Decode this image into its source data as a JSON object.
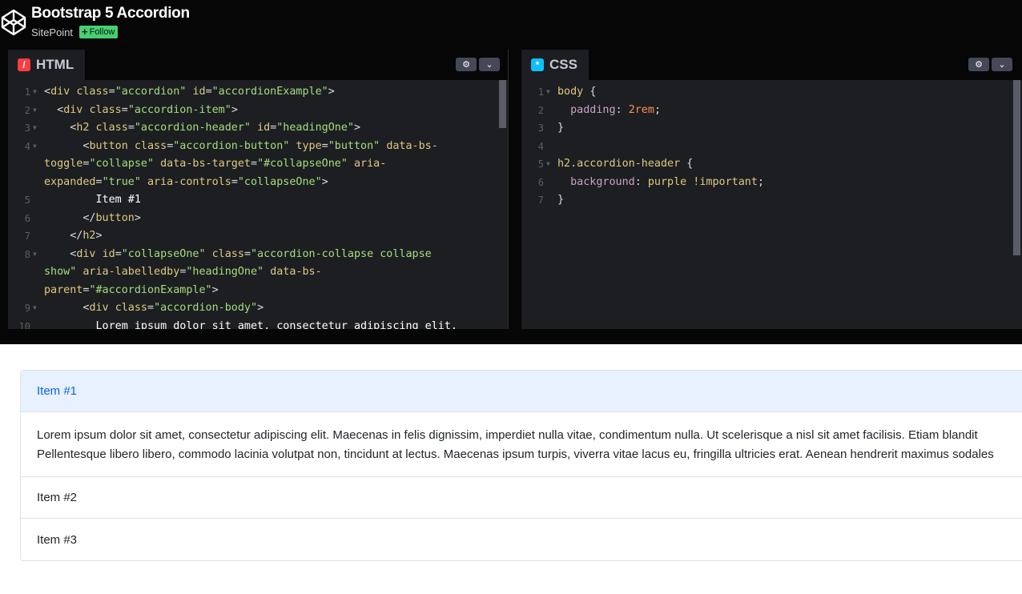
{
  "header": {
    "title": "Bootstrap 5 Accordion",
    "author": "SitePoint",
    "follow_label": "Follow",
    "follow_color": "#47cf73"
  },
  "html_editor": {
    "tab_label": "HTML",
    "icon": "html-icon",
    "lines": [
      {
        "n": "1",
        "fold": true,
        "html": "<span class='t-br'>&lt;</span><span class='t-tag'>div</span> <span class='t-att'>class</span><span class='t-br'>=</span><span class='t-val'>\"accordion\"</span> <span class='t-att'>id</span><span class='t-br'>=</span><span class='t-val'>\"accordionExample\"</span><span class='t-br'>&gt;</span>"
      },
      {
        "n": "2",
        "fold": true,
        "html": "  <span class='t-br'>&lt;</span><span class='t-tag'>div</span> <span class='t-att'>class</span><span class='t-br'>=</span><span class='t-val'>\"accordion-item\"</span><span class='t-br'>&gt;</span>"
      },
      {
        "n": "3",
        "fold": true,
        "html": "    <span class='t-br'>&lt;</span><span class='t-tag'>h2</span> <span class='t-att'>class</span><span class='t-br'>=</span><span class='t-val'>\"accordion-header\"</span> <span class='t-att'>id</span><span class='t-br'>=</span><span class='t-val'>\"headingOne\"</span><span class='t-br'>&gt;</span>"
      },
      {
        "n": "4",
        "fold": true,
        "html": "      <span class='t-br'>&lt;</span><span class='t-tag'>button</span> <span class='t-att'>class</span><span class='t-br'>=</span><span class='t-val'>\"accordion-button\"</span> <span class='t-att'>type</span><span class='t-br'>=</span><span class='t-val'>\"button\"</span> <span class='t-att'>data-bs-</span>"
      },
      {
        "n": "",
        "fold": false,
        "html": "<span class='t-att'>toggle</span><span class='t-br'>=</span><span class='t-val'>\"collapse\"</span> <span class='t-att'>data-bs-target</span><span class='t-br'>=</span><span class='t-val'>\"#collapseOne\"</span> <span class='t-att'>aria-</span>"
      },
      {
        "n": "",
        "fold": false,
        "html": "<span class='t-att'>expanded</span><span class='t-br'>=</span><span class='t-val'>\"true\"</span> <span class='t-att'>aria-controls</span><span class='t-br'>=</span><span class='t-val'>\"collapseOne\"</span><span class='t-br'>&gt;</span>"
      },
      {
        "n": "5",
        "fold": false,
        "html": "        Item #1"
      },
      {
        "n": "6",
        "fold": false,
        "html": "      <span class='t-br'>&lt;/</span><span class='t-tag'>button</span><span class='t-br'>&gt;</span>"
      },
      {
        "n": "7",
        "fold": false,
        "html": "    <span class='t-br'>&lt;/</span><span class='t-tag'>h2</span><span class='t-br'>&gt;</span>"
      },
      {
        "n": "8",
        "fold": true,
        "html": "    <span class='t-br'>&lt;</span><span class='t-tag'>div</span> <span class='t-att'>id</span><span class='t-br'>=</span><span class='t-val'>\"collapseOne\"</span> <span class='t-att'>class</span><span class='t-br'>=</span><span class='t-val'>\"accordion-collapse collapse</span>"
      },
      {
        "n": "",
        "fold": false,
        "html": "<span class='t-val'>show\"</span> <span class='t-att'>aria-labelledby</span><span class='t-br'>=</span><span class='t-val'>\"headingOne\"</span> <span class='t-att'>data-bs-</span>"
      },
      {
        "n": "",
        "fold": false,
        "html": "<span class='t-att'>parent</span><span class='t-br'>=</span><span class='t-val'>\"#accordionExample\"</span><span class='t-br'>&gt;</span>"
      },
      {
        "n": "9",
        "fold": true,
        "html": "      <span class='t-br'>&lt;</span><span class='t-tag'>div</span> <span class='t-att'>class</span><span class='t-br'>=</span><span class='t-val'>\"accordion-body\"</span><span class='t-br'>&gt;</span>"
      },
      {
        "n": "10",
        "fold": false,
        "html": "        Lorem ipsum dolor sit amet, consectetur adipiscing elit."
      }
    ]
  },
  "css_editor": {
    "tab_label": "CSS",
    "icon": "css-icon",
    "lines": [
      {
        "n": "1",
        "fold": true,
        "html": "<span class='t-sel'>body</span> <span class='t-br'>{</span>"
      },
      {
        "n": "2",
        "fold": false,
        "html": "  <span class='t-prop'>padding</span><span class='t-br'>:</span> <span class='t-num'>2rem</span><span class='t-br'>;</span>"
      },
      {
        "n": "3",
        "fold": false,
        "html": "<span class='t-br'>}</span>"
      },
      {
        "n": "4",
        "fold": false,
        "html": ""
      },
      {
        "n": "5",
        "fold": true,
        "html": "<span class='t-sel'>h2.accordion-header</span> <span class='t-br'>{</span>"
      },
      {
        "n": "6",
        "fold": false,
        "html": "  <span class='t-prop'>background</span><span class='t-br'>:</span> <span class='t-kw'>purple !important</span><span class='t-br'>;</span>"
      },
      {
        "n": "7",
        "fold": false,
        "html": "<span class='t-br'>}</span>"
      }
    ]
  },
  "preview": {
    "item1": "Item #1",
    "body_line1": "Lorem ipsum dolor sit amet, consectetur adipiscing elit. Maecenas in felis dignissim, imperdiet nulla vitae, condimentum nulla. Ut scelerisque a nisl sit amet facilisis. Etiam blandit",
    "body_line2": "Pellentesque libero libero, commodo lacinia volutpat non, tincidunt at lectus. Maecenas ipsum turpis, viverra vitae lacus eu, fringilla ultricies erat. Aenean hendrerit maximus sodales",
    "item2": "Item #2",
    "item3": "Item #3",
    "active_color": "#0c63e4",
    "active_bg": "#e7f1ff"
  }
}
